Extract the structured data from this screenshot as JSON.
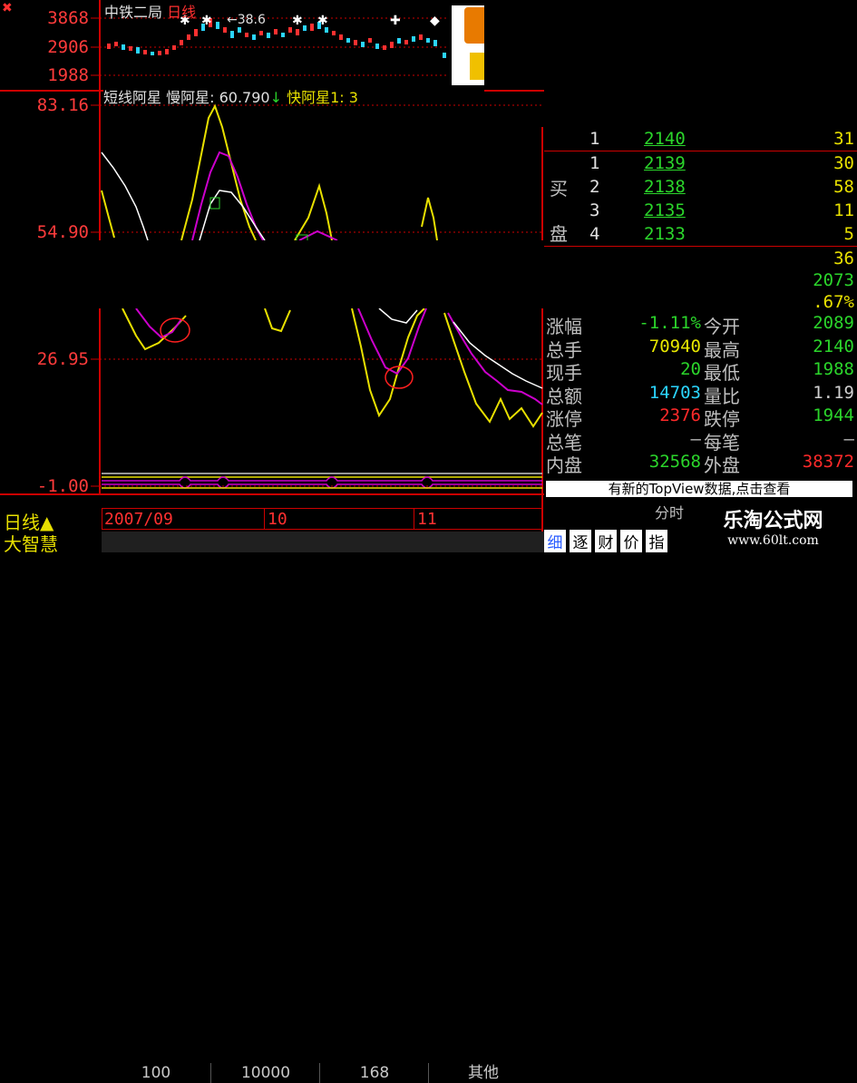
{
  "app": {
    "left_icon": "✖",
    "stock_name": "中铁二局",
    "period": "日线"
  },
  "price_axis": [
    "3868",
    "2906",
    "1988"
  ],
  "price_marker": "38.6",
  "indicator": {
    "name": "短线阿星",
    "slow_label": "慢阿星:",
    "slow_value": "60.790",
    "slow_arrow": "↓",
    "fast_label": "快阿星1:",
    "fast_value": "3"
  },
  "indicator_axis": [
    "83.16",
    "54.90",
    "26.95",
    "-1.00"
  ],
  "order_book": {
    "sell": [
      {
        "level": "1",
        "price": "2140",
        "vol": "31"
      }
    ],
    "buy_label_1": "买",
    "buy_label_2": "盘",
    "buy": [
      {
        "level": "1",
        "price": "2139",
        "vol": "30"
      },
      {
        "level": "2",
        "price": "2138",
        "vol": "58"
      },
      {
        "level": "3",
        "price": "2135",
        "vol": "11"
      },
      {
        "level": "4",
        "price": "2133",
        "vol": "5"
      }
    ],
    "extra_values": [
      "36",
      "2073",
      ".67%"
    ]
  },
  "stats": [
    {
      "l1": "涨幅",
      "v1": "-1.11%",
      "c1": "#2bd52b",
      "l2": "今开",
      "v2": "2089",
      "c2": "#2bd52b"
    },
    {
      "l1": "总手",
      "v1": "70940",
      "c1": "#e8e800",
      "l2": "最高",
      "v2": "2140",
      "c2": "#2bd52b"
    },
    {
      "l1": "现手",
      "v1": "20",
      "c1": "#2bd52b",
      "l2": "最低",
      "v2": "1988",
      "c2": "#2bd52b"
    },
    {
      "l1": "总额",
      "v1": "14703",
      "c1": "#2bd5ff",
      "l2": "量比",
      "v2": "1.19",
      "c2": "#d0d0d0"
    },
    {
      "l1": "涨停",
      "v1": "2376",
      "c1": "#ff2a2a",
      "l2": "跌停",
      "v2": "1944",
      "c2": "#2bd52b"
    },
    {
      "l1": "总笔",
      "v1": "—",
      "c1": "#c0c0c0",
      "l2": "每笔",
      "v2": "—",
      "c2": "#c0c0c0"
    },
    {
      "l1": "内盘",
      "v1": "32568",
      "c1": "#2bd52b",
      "l2": "外盘",
      "v2": "38372",
      "c2": "#ff2a2a"
    }
  ],
  "notice": "有新的TopView数据,点击查看",
  "period_bar": {
    "label": "日线",
    "arrow": "▲",
    "dates": [
      "2007/09",
      "10",
      "11"
    ],
    "share_label": "分时"
  },
  "bottom": {
    "brand": "大智慧",
    "tabs": [
      "100",
      "10000",
      "168",
      "其他"
    ],
    "small_tabs": [
      "细",
      "逐",
      "财",
      "价",
      "指"
    ]
  },
  "watermark": {
    "title": "乐淘公式网",
    "url": "www.60lt.com"
  },
  "colors": {
    "up_red": "#ff3030",
    "down_green": "#2bd52b",
    "fast_line": "#e8e000",
    "slow_line": "#cc00cc",
    "white_line": "#ffffff",
    "grid_red": "#cc0000"
  }
}
